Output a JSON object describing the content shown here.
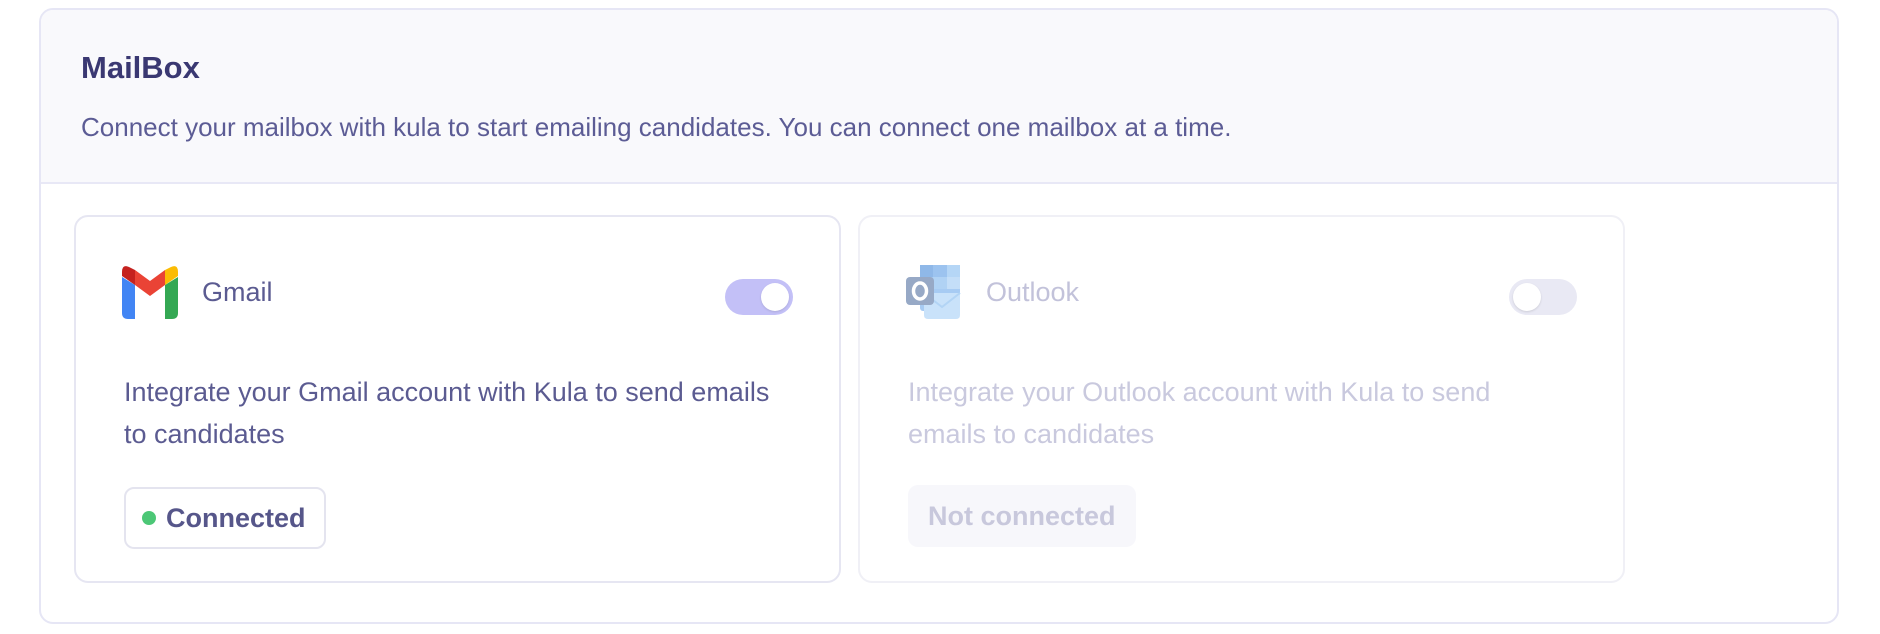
{
  "section": {
    "title": "MailBox",
    "description": "Connect your mailbox with kula to start emailing candidates. You can connect one mailbox at a time."
  },
  "providers": [
    {
      "name": "Gmail",
      "icon": "gmail-icon",
      "enabled": true,
      "description": "Integrate your Gmail account with Kula to send emails to candidates",
      "status": "Connected",
      "status_color": "#4cc776"
    },
    {
      "name": "Outlook",
      "icon": "outlook-icon",
      "enabled": false,
      "description": "Integrate your Outlook account with Kula to send emails to candidates",
      "status": "Not connected"
    }
  ],
  "colors": {
    "accent": "#c3c0f7",
    "title": "#3a3872",
    "text": "#5b5b91",
    "disabled_text": "#c2c2da"
  }
}
